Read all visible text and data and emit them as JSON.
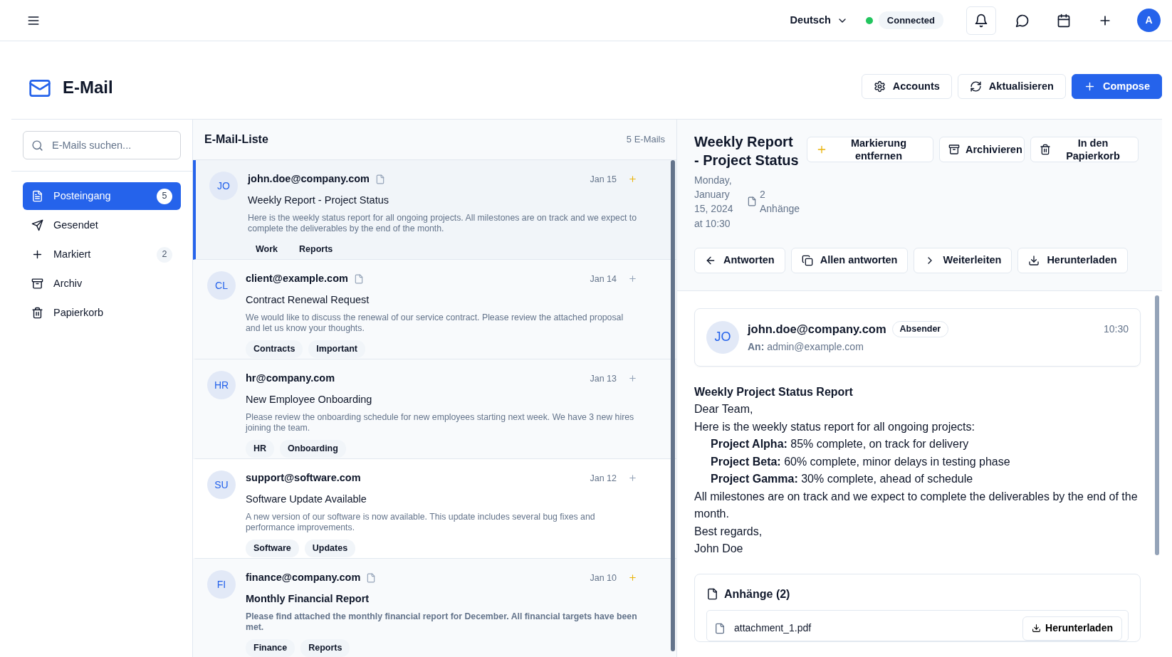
{
  "topbar": {
    "language": "Deutsch",
    "connection": {
      "label": "Connected",
      "connected": true
    },
    "avatar": "A"
  },
  "header": {
    "title": "E-Mail",
    "buttons": [
      {
        "label": "Accounts",
        "primary": false
      },
      {
        "label": "Aktualisieren",
        "primary": false
      },
      {
        "label": "Compose",
        "primary": true
      }
    ]
  },
  "search": {
    "placeholder": "E-Mails suchen..."
  },
  "folders": [
    {
      "label": "Posteingang",
      "count": "5",
      "selected": true
    },
    {
      "label": "Gesendet",
      "selected": false
    },
    {
      "label": "Markiert",
      "count": "2",
      "selected": false
    },
    {
      "label": "Archiv",
      "selected": false
    },
    {
      "label": "Papierkorb",
      "selected": false
    }
  ],
  "list": {
    "title": "E-Mail-Liste",
    "count": "5 E-Mails",
    "emails": [
      {
        "initials": "JO",
        "sender": "john.doe@company.com",
        "has_attachment": true,
        "date": "Jan 15",
        "flagged": true,
        "subject": "Weekly Report - Project Status",
        "preview": "Here is the weekly status report for all ongoing projects. All milestones are on track and we expect to complete the deliverables by the end of the month.",
        "tags": [
          "Work",
          "Reports"
        ],
        "selected": true,
        "unread": false
      },
      {
        "initials": "CL",
        "sender": "client@example.com",
        "has_attachment": true,
        "date": "Jan 14",
        "flagged": false,
        "subject": "Contract Renewal Request",
        "preview": "We would like to discuss the renewal of our service contract. Please review the attached proposal and let us know your thoughts.",
        "tags": [
          "Contracts",
          "Important"
        ],
        "selected": false,
        "unread": false
      },
      {
        "initials": "HR",
        "sender": "hr@company.com",
        "has_attachment": false,
        "date": "Jan 13",
        "flagged": false,
        "subject": "New Employee Onboarding",
        "preview": "Please review the onboarding schedule for new employees starting next week. We have 3 new hires joining the team.",
        "tags": [
          "HR",
          "Onboarding"
        ],
        "selected": false,
        "unread": false
      },
      {
        "initials": "SU",
        "sender": "support@software.com",
        "has_attachment": false,
        "date": "Jan 12",
        "flagged": false,
        "subject": "Software Update Available",
        "preview": "A new version of our software is now available. This update includes several bug fixes and performance improvements.",
        "tags": [
          "Software",
          "Updates"
        ],
        "selected": false,
        "unread": false
      },
      {
        "initials": "FI",
        "sender": "finance@company.com",
        "has_attachment": true,
        "date": "Jan 10",
        "flagged": true,
        "subject": "Monthly Financial Report",
        "preview": "Please find attached the monthly financial report for December. All financial targets have been met.",
        "tags": [
          "Finance",
          "Reports"
        ],
        "selected": false,
        "unread": true
      }
    ]
  },
  "detail": {
    "title": "Weekly Report - Project Status",
    "flagged": true,
    "top_buttons": [
      "Markierung entfernen",
      "Archivieren",
      "In den Papierkorb"
    ],
    "date": "Monday, January 15, 2024 at 10:30",
    "attachment_count": "2 Anhänge",
    "actions": [
      "Antworten",
      "Allen antworten",
      "Weiterleiten",
      "Herunterladen"
    ],
    "sender": {
      "initials": "JO",
      "email": "john.doe@company.com",
      "badge": "Absender",
      "to": "**An:** admin@example.com",
      "time": "10:30"
    },
    "body": [
      {
        "kind": "heading",
        "text": "Weekly Project Status Report"
      },
      {
        "kind": "line",
        "text": "Dear Team,"
      },
      {
        "kind": "line",
        "text": "Here is the weekly status report for all ongoing projects:"
      },
      {
        "kind": "item",
        "text": "**Project Alpha:** 85% complete, on track for delivery"
      },
      {
        "kind": "item",
        "text": "**Project Beta:** 60% complete, minor delays in testing phase"
      },
      {
        "kind": "item",
        "text": "**Project Gamma:** 30% complete, ahead of schedule"
      },
      {
        "kind": "line",
        "text": "All milestones are on track and we expect to complete the deliverables by the end of the month."
      },
      {
        "kind": "line",
        "text": "Best regards,"
      },
      {
        "kind": "line",
        "text": "John Doe"
      }
    ],
    "attachments": {
      "title": "Anhänge (2)",
      "files": [
        {
          "name": "attachment_1.pdf",
          "button": "Herunterladen"
        }
      ]
    }
  }
}
